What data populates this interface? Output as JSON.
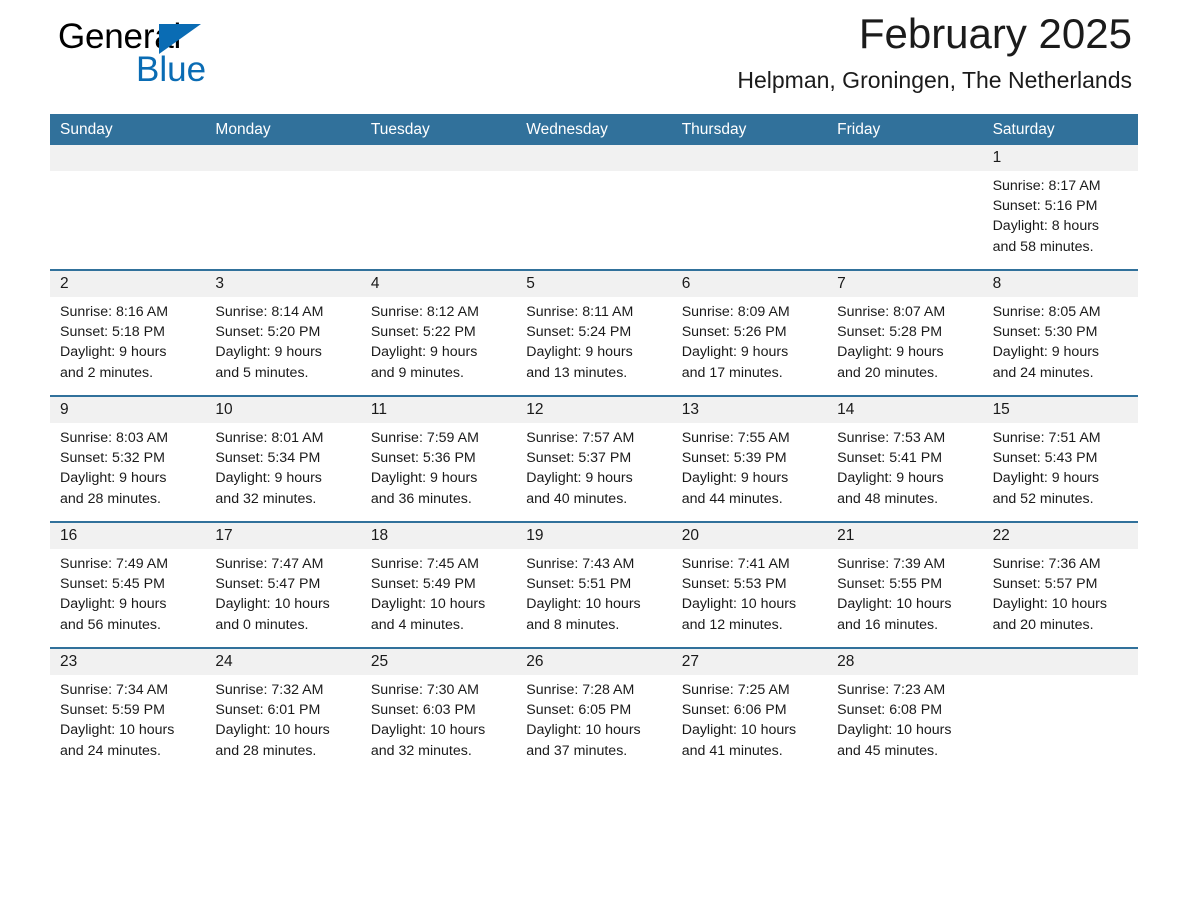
{
  "brand": {
    "name_part1": "General",
    "name_part2": "Blue",
    "triangle_color": "#0a6cb4"
  },
  "header": {
    "title": "February 2025",
    "subtitle": "Helpman, Groningen, The Netherlands"
  },
  "theme": {
    "header_blue": "#31719b",
    "row_divider_blue": "#31719b",
    "daynum_band": "#f1f1f1",
    "page_background": "#ffffff",
    "text_color": "#1a1a1a"
  },
  "weekdays": [
    "Sunday",
    "Monday",
    "Tuesday",
    "Wednesday",
    "Thursday",
    "Friday",
    "Saturday"
  ],
  "weeks": [
    [
      {
        "day": "",
        "empty": true
      },
      {
        "day": "",
        "empty": true
      },
      {
        "day": "",
        "empty": true
      },
      {
        "day": "",
        "empty": true
      },
      {
        "day": "",
        "empty": true
      },
      {
        "day": "",
        "empty": true
      },
      {
        "day": "1",
        "sunrise": "Sunrise: 8:17 AM",
        "sunset": "Sunset: 5:16 PM",
        "daylight_line1": "Daylight: 8 hours",
        "daylight_line2": "and 58 minutes."
      }
    ],
    [
      {
        "day": "2",
        "sunrise": "Sunrise: 8:16 AM",
        "sunset": "Sunset: 5:18 PM",
        "daylight_line1": "Daylight: 9 hours",
        "daylight_line2": "and 2 minutes."
      },
      {
        "day": "3",
        "sunrise": "Sunrise: 8:14 AM",
        "sunset": "Sunset: 5:20 PM",
        "daylight_line1": "Daylight: 9 hours",
        "daylight_line2": "and 5 minutes."
      },
      {
        "day": "4",
        "sunrise": "Sunrise: 8:12 AM",
        "sunset": "Sunset: 5:22 PM",
        "daylight_line1": "Daylight: 9 hours",
        "daylight_line2": "and 9 minutes."
      },
      {
        "day": "5",
        "sunrise": "Sunrise: 8:11 AM",
        "sunset": "Sunset: 5:24 PM",
        "daylight_line1": "Daylight: 9 hours",
        "daylight_line2": "and 13 minutes."
      },
      {
        "day": "6",
        "sunrise": "Sunrise: 8:09 AM",
        "sunset": "Sunset: 5:26 PM",
        "daylight_line1": "Daylight: 9 hours",
        "daylight_line2": "and 17 minutes."
      },
      {
        "day": "7",
        "sunrise": "Sunrise: 8:07 AM",
        "sunset": "Sunset: 5:28 PM",
        "daylight_line1": "Daylight: 9 hours",
        "daylight_line2": "and 20 minutes."
      },
      {
        "day": "8",
        "sunrise": "Sunrise: 8:05 AM",
        "sunset": "Sunset: 5:30 PM",
        "daylight_line1": "Daylight: 9 hours",
        "daylight_line2": "and 24 minutes."
      }
    ],
    [
      {
        "day": "9",
        "sunrise": "Sunrise: 8:03 AM",
        "sunset": "Sunset: 5:32 PM",
        "daylight_line1": "Daylight: 9 hours",
        "daylight_line2": "and 28 minutes."
      },
      {
        "day": "10",
        "sunrise": "Sunrise: 8:01 AM",
        "sunset": "Sunset: 5:34 PM",
        "daylight_line1": "Daylight: 9 hours",
        "daylight_line2": "and 32 minutes."
      },
      {
        "day": "11",
        "sunrise": "Sunrise: 7:59 AM",
        "sunset": "Sunset: 5:36 PM",
        "daylight_line1": "Daylight: 9 hours",
        "daylight_line2": "and 36 minutes."
      },
      {
        "day": "12",
        "sunrise": "Sunrise: 7:57 AM",
        "sunset": "Sunset: 5:37 PM",
        "daylight_line1": "Daylight: 9 hours",
        "daylight_line2": "and 40 minutes."
      },
      {
        "day": "13",
        "sunrise": "Sunrise: 7:55 AM",
        "sunset": "Sunset: 5:39 PM",
        "daylight_line1": "Daylight: 9 hours",
        "daylight_line2": "and 44 minutes."
      },
      {
        "day": "14",
        "sunrise": "Sunrise: 7:53 AM",
        "sunset": "Sunset: 5:41 PM",
        "daylight_line1": "Daylight: 9 hours",
        "daylight_line2": "and 48 minutes."
      },
      {
        "day": "15",
        "sunrise": "Sunrise: 7:51 AM",
        "sunset": "Sunset: 5:43 PM",
        "daylight_line1": "Daylight: 9 hours",
        "daylight_line2": "and 52 minutes."
      }
    ],
    [
      {
        "day": "16",
        "sunrise": "Sunrise: 7:49 AM",
        "sunset": "Sunset: 5:45 PM",
        "daylight_line1": "Daylight: 9 hours",
        "daylight_line2": "and 56 minutes."
      },
      {
        "day": "17",
        "sunrise": "Sunrise: 7:47 AM",
        "sunset": "Sunset: 5:47 PM",
        "daylight_line1": "Daylight: 10 hours",
        "daylight_line2": "and 0 minutes."
      },
      {
        "day": "18",
        "sunrise": "Sunrise: 7:45 AM",
        "sunset": "Sunset: 5:49 PM",
        "daylight_line1": "Daylight: 10 hours",
        "daylight_line2": "and 4 minutes."
      },
      {
        "day": "19",
        "sunrise": "Sunrise: 7:43 AM",
        "sunset": "Sunset: 5:51 PM",
        "daylight_line1": "Daylight: 10 hours",
        "daylight_line2": "and 8 minutes."
      },
      {
        "day": "20",
        "sunrise": "Sunrise: 7:41 AM",
        "sunset": "Sunset: 5:53 PM",
        "daylight_line1": "Daylight: 10 hours",
        "daylight_line2": "and 12 minutes."
      },
      {
        "day": "21",
        "sunrise": "Sunrise: 7:39 AM",
        "sunset": "Sunset: 5:55 PM",
        "daylight_line1": "Daylight: 10 hours",
        "daylight_line2": "and 16 minutes."
      },
      {
        "day": "22",
        "sunrise": "Sunrise: 7:36 AM",
        "sunset": "Sunset: 5:57 PM",
        "daylight_line1": "Daylight: 10 hours",
        "daylight_line2": "and 20 minutes."
      }
    ],
    [
      {
        "day": "23",
        "sunrise": "Sunrise: 7:34 AM",
        "sunset": "Sunset: 5:59 PM",
        "daylight_line1": "Daylight: 10 hours",
        "daylight_line2": "and 24 minutes."
      },
      {
        "day": "24",
        "sunrise": "Sunrise: 7:32 AM",
        "sunset": "Sunset: 6:01 PM",
        "daylight_line1": "Daylight: 10 hours",
        "daylight_line2": "and 28 minutes."
      },
      {
        "day": "25",
        "sunrise": "Sunrise: 7:30 AM",
        "sunset": "Sunset: 6:03 PM",
        "daylight_line1": "Daylight: 10 hours",
        "daylight_line2": "and 32 minutes."
      },
      {
        "day": "26",
        "sunrise": "Sunrise: 7:28 AM",
        "sunset": "Sunset: 6:05 PM",
        "daylight_line1": "Daylight: 10 hours",
        "daylight_line2": "and 37 minutes."
      },
      {
        "day": "27",
        "sunrise": "Sunrise: 7:25 AM",
        "sunset": "Sunset: 6:06 PM",
        "daylight_line1": "Daylight: 10 hours",
        "daylight_line2": "and 41 minutes."
      },
      {
        "day": "28",
        "sunrise": "Sunrise: 7:23 AM",
        "sunset": "Sunset: 6:08 PM",
        "daylight_line1": "Daylight: 10 hours",
        "daylight_line2": "and 45 minutes."
      },
      {
        "day": "",
        "empty": true
      }
    ]
  ]
}
